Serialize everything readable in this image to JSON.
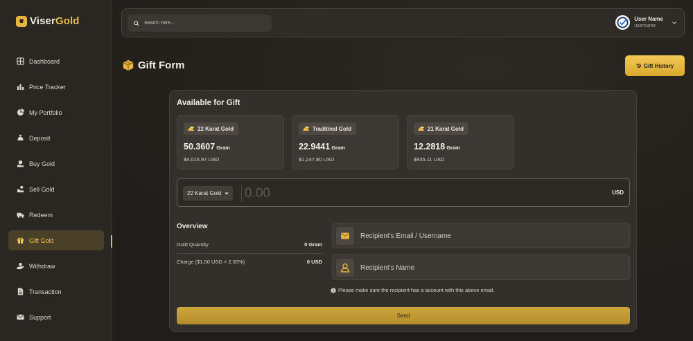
{
  "brand": {
    "part1": "Viser",
    "part2": "Gold"
  },
  "sidebar": {
    "items": [
      {
        "label": "Dashboard",
        "icon": "dashboard-icon"
      },
      {
        "label": "Price Tracker",
        "icon": "chart-icon"
      },
      {
        "label": "My Portfolio",
        "icon": "pie-chart-icon"
      },
      {
        "label": "Deposit",
        "icon": "money-bag-icon"
      },
      {
        "label": "Buy Gold",
        "icon": "buy-icon"
      },
      {
        "label": "Sell Gold",
        "icon": "sell-icon"
      },
      {
        "label": "Redeem",
        "icon": "truck-icon"
      },
      {
        "label": "Gift Gold",
        "icon": "gift-icon"
      },
      {
        "label": "Withdraw",
        "icon": "withdraw-icon"
      },
      {
        "label": "Transaction",
        "icon": "file-icon"
      },
      {
        "label": "Support",
        "icon": "envelope-icon"
      }
    ],
    "active": "Gift Gold"
  },
  "header": {
    "search_placeholder": "Search here...",
    "user_name": "User Name",
    "user_sub": "username"
  },
  "page": {
    "title": "Gift Form",
    "history_button": "Gift History"
  },
  "available": {
    "title": "Available for Gift",
    "cards": [
      {
        "label": "22 Karat Gold",
        "amount": "50.3607",
        "unit": "Gram",
        "usd": "$4,016.97 USD"
      },
      {
        "label": "Traditinal Gold",
        "amount": "22.9441",
        "unit": "Gram",
        "usd": "$1,247.80 USD"
      },
      {
        "label": "21 Karat Gold",
        "amount": "12.2818",
        "unit": "Gram",
        "usd": "$935.11 USD"
      }
    ]
  },
  "form": {
    "selected_gold": "22 Karat Gold",
    "amount_placeholder": "0.00",
    "currency": "USD",
    "email_placeholder": "Recipient's Email / Username",
    "name_placeholder": "Recipient's Name",
    "note": "Please make sure the recipient has a account with this above email.",
    "send_label": "Send"
  },
  "overview": {
    "title": "Overview",
    "rows": [
      {
        "label": "Gold Quantity",
        "value": "0 Gram"
      },
      {
        "label": "Charge ($1.00 USD + 2.00%)",
        "value": "0 USD"
      }
    ]
  },
  "colors": {
    "accent": "#e6b53f",
    "active_bg": "#4a3f27",
    "background": "#24211e"
  }
}
